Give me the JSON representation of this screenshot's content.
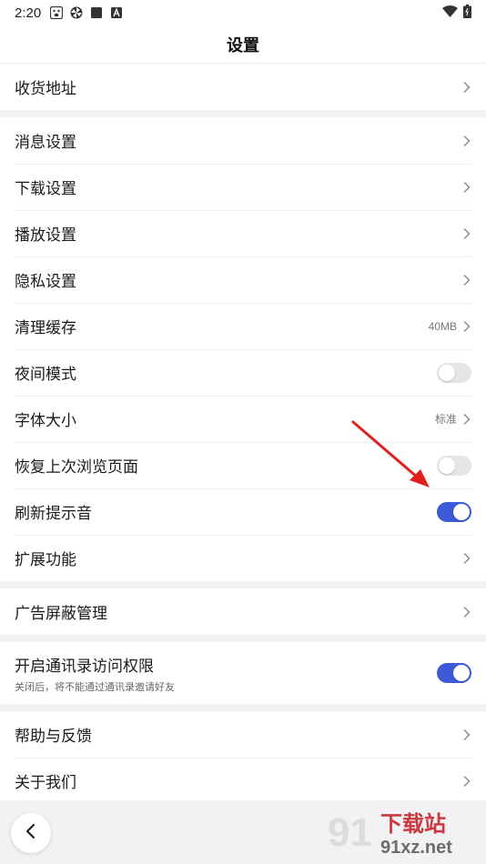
{
  "status_bar": {
    "time": "2:20"
  },
  "title": "设置",
  "groups": {
    "address": {
      "label": "收货地址"
    },
    "main": [
      {
        "label": "消息设置"
      },
      {
        "label": "下载设置"
      },
      {
        "label": "播放设置"
      },
      {
        "label": "隐私设置"
      },
      {
        "label": "清理缓存",
        "value": "40MB"
      },
      {
        "label": "夜间模式",
        "toggle": false
      },
      {
        "label": "字体大小",
        "value": "标准"
      },
      {
        "label": "恢复上次浏览页面",
        "toggle": false
      },
      {
        "label": "刷新提示音",
        "toggle": true
      },
      {
        "label": "扩展功能"
      }
    ],
    "ads": {
      "label": "广告屏蔽管理"
    },
    "contacts": {
      "label": "开启通讯录访问权限",
      "sub": "关闭后，将不能通过通讯录邀请好友",
      "toggle": true
    },
    "help": [
      {
        "label": "帮助与反馈"
      },
      {
        "label": "关于我们"
      }
    ]
  },
  "watermark": {
    "text_top": "下载站",
    "text_bottom": "91xz.net"
  },
  "colors": {
    "toggle_on": "#3d5bd9",
    "toggle_off": "#e6e6e9",
    "arrow": "#e0201f"
  },
  "icons": [
    "back-arrow-icon",
    "chevron-right-icon",
    "wifi-icon",
    "battery-icon"
  ]
}
